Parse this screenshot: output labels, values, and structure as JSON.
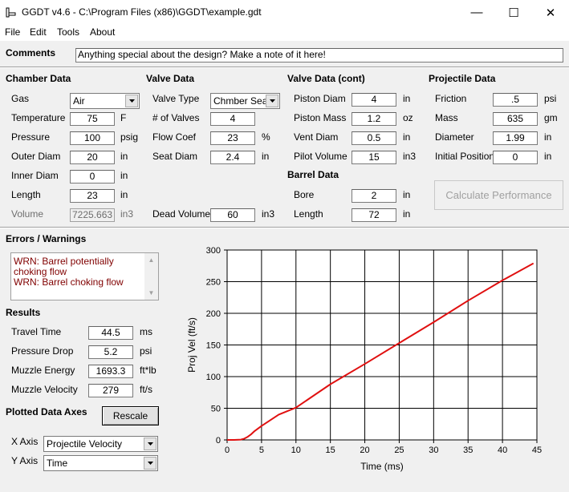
{
  "window": {
    "title": "GGDT v4.6 - C:\\Program Files (x86)\\GGDT\\example.gdt",
    "minimize": "—",
    "maximize": "☐",
    "close": "✕"
  },
  "menu": [
    "File",
    "Edit",
    "Tools",
    "About"
  ],
  "comments": {
    "label": "Comments",
    "value": "Anything special about the design?  Make a note of it here!"
  },
  "chamber": {
    "title": "Chamber Data",
    "gas_label": "Gas",
    "gas_value": "Air",
    "temperature_label": "Temperature",
    "temperature_value": "75",
    "temperature_unit": "F",
    "pressure_label": "Pressure",
    "pressure_value": "100",
    "pressure_unit": "psig",
    "outer_label": "Outer Diam",
    "outer_value": "20",
    "outer_unit": "in",
    "inner_label": "Inner Diam",
    "inner_value": "0",
    "inner_unit": "in",
    "length_label": "Length",
    "length_value": "23",
    "length_unit": "in",
    "volume_label": "Volume",
    "volume_value": "7225.663",
    "volume_unit": "in3"
  },
  "valve": {
    "title": "Valve Data",
    "type_label": "Valve Type",
    "type_value": "Chmber Seal",
    "valves_label": "# of Valves",
    "valves_value": "4",
    "flow_label": "Flow Coef",
    "flow_value": "23",
    "flow_unit": "%",
    "seat_label": "Seat Diam",
    "seat_value": "2.4",
    "seat_unit": "in",
    "dead_label": "Dead Volume",
    "dead_value": "60",
    "dead_unit": "in3"
  },
  "valve_cont": {
    "title": "Valve Data (cont)",
    "piston_diam_label": "Piston Diam",
    "piston_diam_value": "4",
    "piston_diam_unit": "in",
    "piston_mass_label": "Piston Mass",
    "piston_mass_value": "1.2",
    "piston_mass_unit": "oz",
    "vent_label": "Vent Diam",
    "vent_value": "0.5",
    "vent_unit": "in",
    "pilot_label": "Pilot Volume",
    "pilot_value": "15",
    "pilot_unit": "in3"
  },
  "barrel": {
    "title": "Barrel Data",
    "bore_label": "Bore",
    "bore_value": "2",
    "bore_unit": "in",
    "length_label": "Length",
    "length_value": "72",
    "length_unit": "in"
  },
  "projectile": {
    "title": "Projectile Data",
    "friction_label": "Friction",
    "friction_value": ".5",
    "friction_unit": "psi",
    "mass_label": "Mass",
    "mass_value": "635",
    "mass_unit": "gm",
    "diameter_label": "Diameter",
    "diameter_value": "1.99",
    "diameter_unit": "in",
    "position_label": "Initial Position",
    "position_value": "0",
    "position_unit": "in"
  },
  "calculate_label": "Calculate Performance",
  "errors": {
    "title": "Errors / Warnings",
    "messages": [
      "WRN: Barrel potentially choking flow",
      "WRN: Barrel choking flow"
    ]
  },
  "results": {
    "title": "Results",
    "travel_label": "Travel Time",
    "travel_value": "44.5",
    "travel_unit": "ms",
    "drop_label": "Pressure Drop",
    "drop_value": "5.2",
    "drop_unit": "psi",
    "energy_label": "Muzzle Energy",
    "energy_value": "1693.3",
    "energy_unit": "ft*lb",
    "velocity_label": "Muzzle Velocity",
    "velocity_value": "279",
    "velocity_unit": "ft/s"
  },
  "axes": {
    "title": "Plotted Data Axes",
    "rescale_label": "Rescale",
    "x_label": "X Axis",
    "x_value": "Projectile Velocity",
    "y_label": "Y Axis",
    "y_value": "Time"
  },
  "colors": {
    "curve": "#e01010",
    "grid": "#000000",
    "error_text": "#800000"
  },
  "chart_data": {
    "type": "line",
    "xlabel": "Time (ms)",
    "ylabel": "Proj Vel (ft/s)",
    "xlim": [
      0,
      45
    ],
    "ylim": [
      0,
      300
    ],
    "xticks": [
      "0",
      "5",
      "10",
      "15",
      "20",
      "25",
      "30",
      "35",
      "40",
      "45"
    ],
    "yticks": [
      "0",
      "50",
      "100",
      "150",
      "200",
      "250",
      "300"
    ],
    "grid": true,
    "series": [
      {
        "color": "#e01010",
        "x": [
          0,
          1,
          2,
          2.5,
          3,
          3.5,
          4,
          5,
          7.5,
          10,
          15,
          20,
          25,
          30,
          35,
          40,
          44.5
        ],
        "y": [
          0,
          0,
          0.5,
          2,
          5,
          9,
          14,
          22,
          40,
          51,
          88,
          120,
          153,
          186,
          220,
          252,
          279
        ]
      }
    ]
  }
}
